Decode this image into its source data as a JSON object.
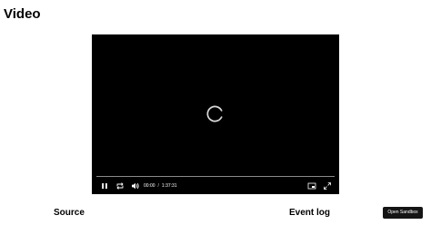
{
  "page": {
    "title": "Video"
  },
  "player": {
    "state": "loading",
    "progress": 0,
    "current_time": "00:00",
    "separator": "/",
    "duration": "1:37:31",
    "icons": {
      "spinner": "loading-spinner-icon",
      "play_pause": "pause-icon",
      "loop": "loop-icon",
      "volume": "volume-icon",
      "pip": "picture-in-picture-icon",
      "fullscreen": "fullscreen-icon"
    }
  },
  "sections": {
    "source": "Source",
    "event_log": "Event log"
  },
  "actions": {
    "open_sandbox": "Open Sandbox"
  }
}
